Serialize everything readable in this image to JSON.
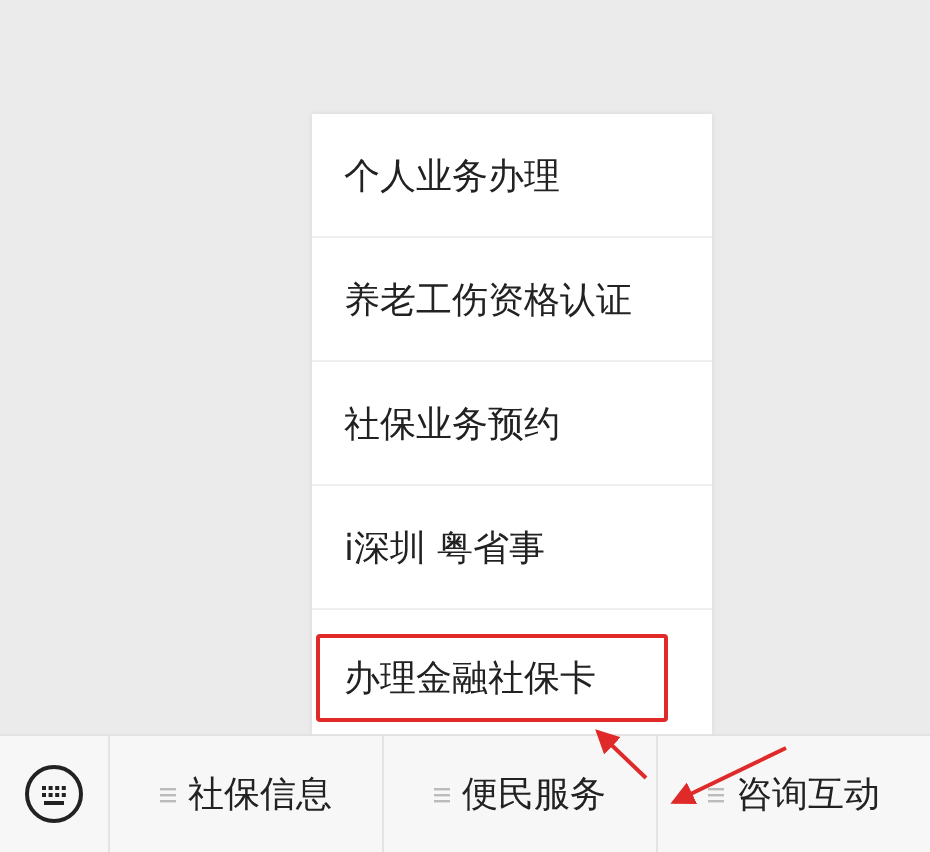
{
  "menu": [
    {
      "label": "个人业务办理",
      "highlighted": false
    },
    {
      "label": "养老工伤资格认证",
      "highlighted": false
    },
    {
      "label": "社保业务预约",
      "highlighted": false
    },
    {
      "label": "i深圳 粤省事",
      "highlighted": false
    },
    {
      "label": "办理金融社保卡",
      "highlighted": true
    }
  ],
  "tabs": [
    {
      "label": "社保信息"
    },
    {
      "label": "便民服务"
    },
    {
      "label": "咨询互动"
    }
  ]
}
